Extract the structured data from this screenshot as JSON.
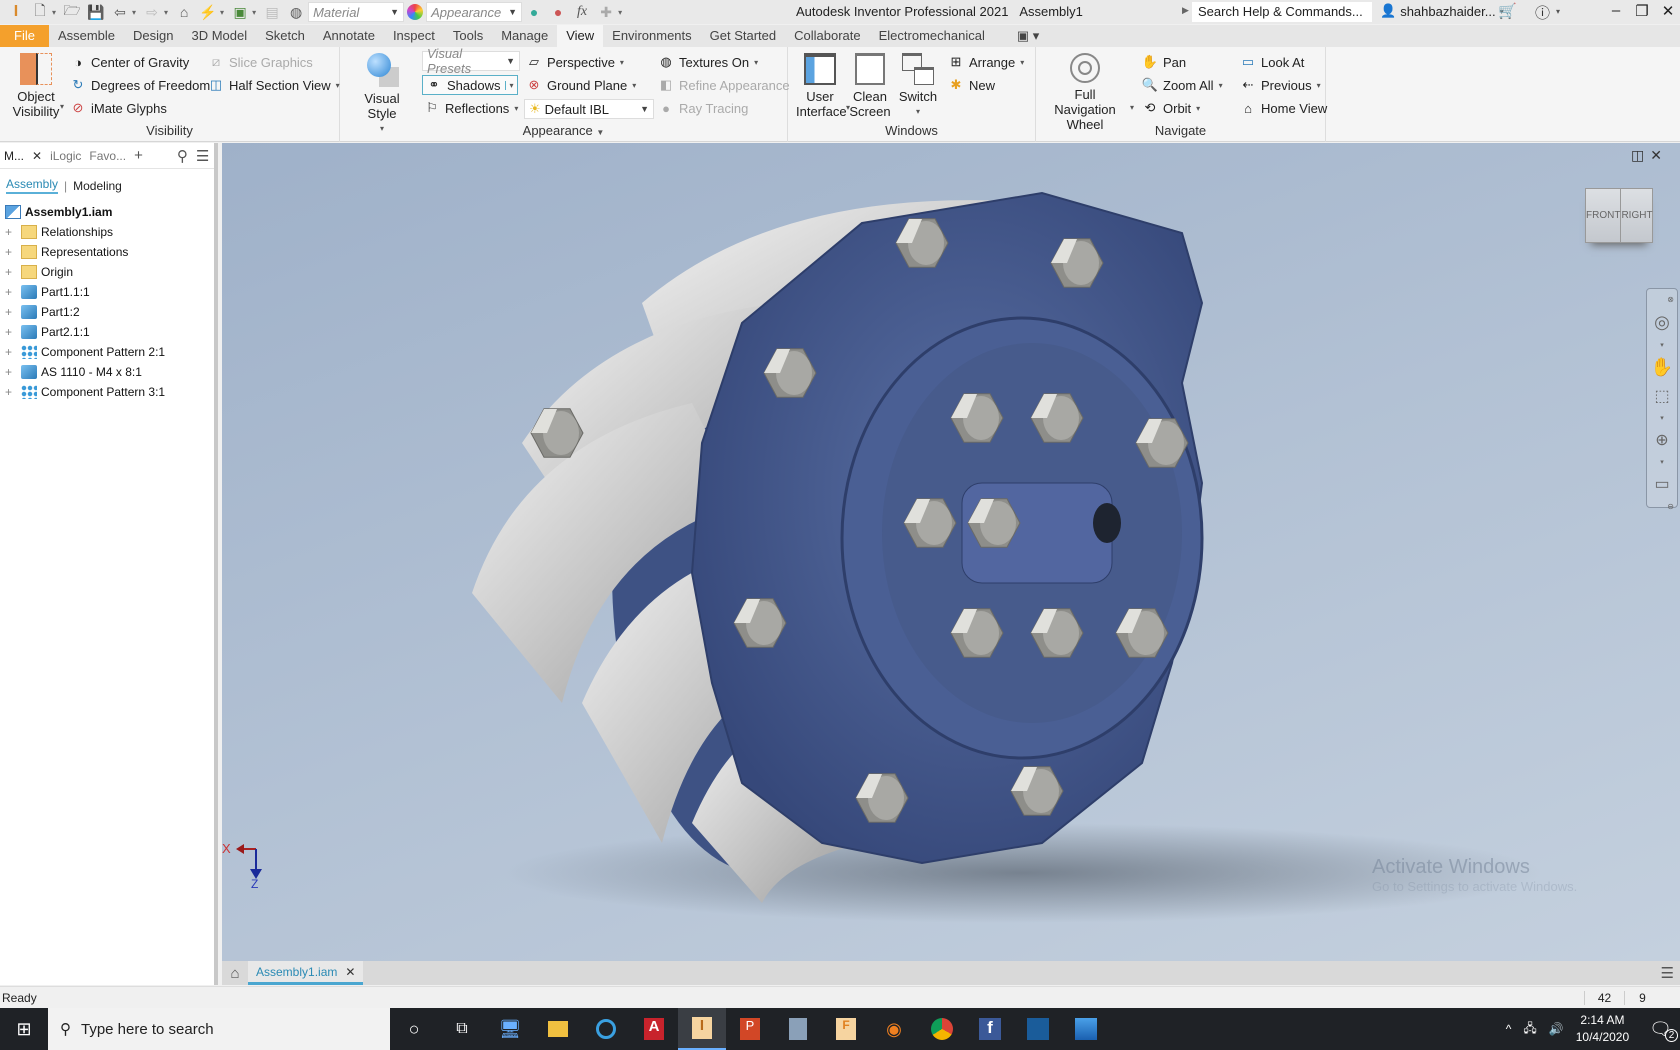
{
  "titlebar": {
    "app_title": "Autodesk Inventor Professional 2021",
    "document": "Assembly1",
    "material_placeholder": "Material",
    "appearance_placeholder": "Appearance",
    "search_help": "Search Help & Commands...",
    "user": "shahbazhaider...",
    "fx": "fx"
  },
  "ribbon_tabs": [
    "File",
    "Assemble",
    "Design",
    "3D Model",
    "Sketch",
    "Annotate",
    "Inspect",
    "Tools",
    "Manage",
    "View",
    "Environments",
    "Get Started",
    "Collaborate",
    "Electromechanical"
  ],
  "active_tab": "View",
  "ribbon": {
    "visibility": {
      "label": "Visibility",
      "object_visibility": [
        "Object",
        "Visibility"
      ],
      "center_of_gravity": "Center of Gravity",
      "degrees_of_freedom": "Degrees of Freedom",
      "imate_glyphs": "iMate Glyphs",
      "slice_graphics": "Slice Graphics",
      "half_section_view": "Half Section View"
    },
    "appearance": {
      "label": "Appearance",
      "visual_style": "Visual Style",
      "visual_presets": "Visual Presets",
      "shadows": "Shadows",
      "reflections": "Reflections",
      "perspective": "Perspective",
      "ground_plane": "Ground Plane",
      "default_ibl": "Default IBL",
      "textures_on": "Textures On",
      "refine_appearance": "Refine Appearance",
      "ray_tracing": "Ray Tracing"
    },
    "windows": {
      "label": "Windows",
      "user_interface": [
        "User",
        "Interface"
      ],
      "clean_screen": [
        "Clean",
        "Screen"
      ],
      "switch": "Switch",
      "arrange": "Arrange",
      "new": "New"
    },
    "navigate": {
      "label": "Navigate",
      "full_nav_wheel": [
        "Full Navigation",
        "Wheel"
      ],
      "pan": "Pan",
      "zoom_all": "Zoom All",
      "orbit": "Orbit",
      "look_at": "Look At",
      "previous": "Previous",
      "home_view": "Home View"
    }
  },
  "browser": {
    "tabs": [
      "M...",
      "iLogic",
      "Favo..."
    ],
    "subtabs": [
      "Assembly",
      "Modeling"
    ],
    "root": "Assembly1.iam",
    "items": [
      {
        "label": "Relationships",
        "icon": "folder"
      },
      {
        "label": "Representations",
        "icon": "representations"
      },
      {
        "label": "Origin",
        "icon": "folder"
      },
      {
        "label": "Part1.1:1",
        "icon": "part-grounded"
      },
      {
        "label": "Part1:2",
        "icon": "part"
      },
      {
        "label": "Part2.1:1",
        "icon": "part"
      },
      {
        "label": "Component Pattern 2:1",
        "icon": "pattern"
      },
      {
        "label": "AS 1110 - M4 x 8:1",
        "icon": "part"
      },
      {
        "label": "Component Pattern 3:1",
        "icon": "pattern"
      }
    ]
  },
  "viewcube": {
    "front": "FRONT",
    "right": "RIGHT"
  },
  "axes": {
    "x": "X",
    "z": "Z"
  },
  "watermark": {
    "line1": "Activate Windows",
    "line2": "Go to Settings to activate Windows."
  },
  "doc_tab": "Assembly1.iam",
  "status": {
    "text": "Ready",
    "count1": "42",
    "count2": "9"
  },
  "taskbar": {
    "search_placeholder": "Type here to search",
    "time": "2:14 AM",
    "date": "10/4/2020",
    "notifications": "2"
  },
  "colors": {
    "file_tab": "#f4a02c",
    "model_blue": "#4a5f8f",
    "accent": "#2a8ab4"
  }
}
